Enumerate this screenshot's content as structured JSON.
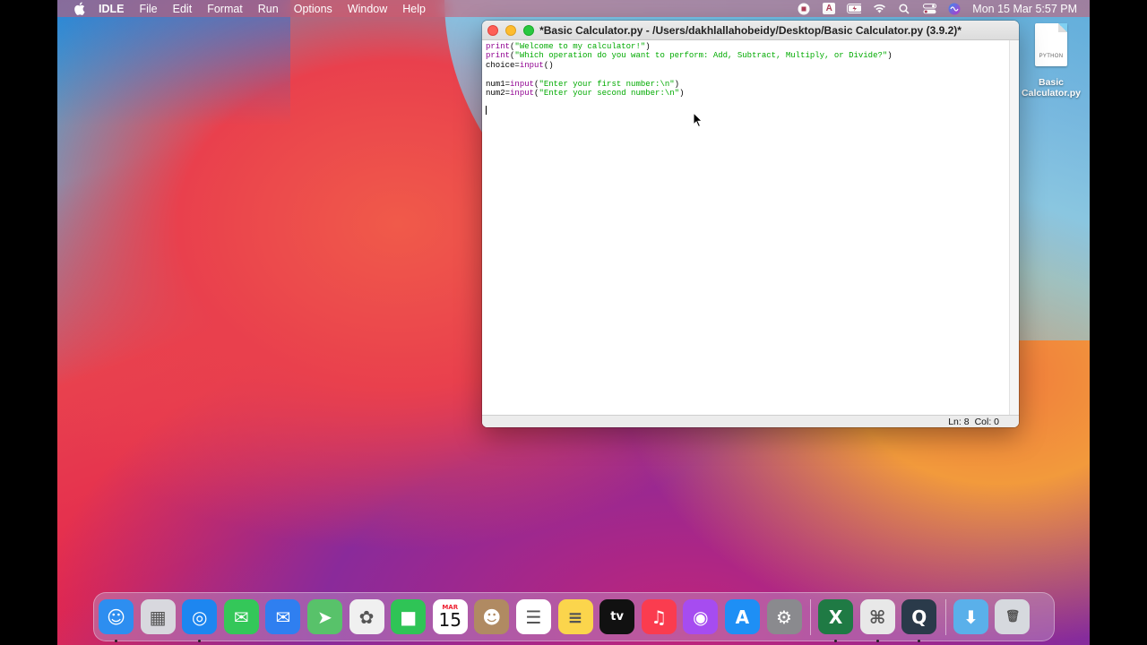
{
  "menubar": {
    "app_name": "IDLE",
    "items": [
      "File",
      "Edit",
      "Format",
      "Run",
      "Options",
      "Window",
      "Help"
    ],
    "input_source": "A",
    "clock": "Mon 15 Mar  5:57 PM"
  },
  "desktop": {
    "file": {
      "tag": "PYTHON",
      "name_line1": "Basic",
      "name_line2": "Calculator.py"
    }
  },
  "window": {
    "title": "*Basic Calculator.py - /Users/dakhlallahobeidy/Desktop/Basic Calculator.py (3.9.2)*",
    "code_lines": [
      [
        {
          "t": "print",
          "c": "kw"
        },
        {
          "t": "(",
          "c": "plain"
        },
        {
          "t": "\"Welcome to my calculator!\"",
          "c": "str"
        },
        {
          "t": ")",
          "c": "plain"
        }
      ],
      [
        {
          "t": "print",
          "c": "kw"
        },
        {
          "t": "(",
          "c": "plain"
        },
        {
          "t": "\"Which operation do you want to perform: Add, Subtract, Multiply, or Divide?\"",
          "c": "str"
        },
        {
          "t": ")",
          "c": "plain"
        }
      ],
      [
        {
          "t": "choice=",
          "c": "plain"
        },
        {
          "t": "input",
          "c": "kw"
        },
        {
          "t": "()",
          "c": "plain"
        }
      ],
      [],
      [
        {
          "t": "num1=",
          "c": "plain"
        },
        {
          "t": "input",
          "c": "kw"
        },
        {
          "t": "(",
          "c": "plain"
        },
        {
          "t": "\"Enter your first number:\\n\"",
          "c": "str"
        },
        {
          "t": ")",
          "c": "plain"
        }
      ],
      [
        {
          "t": "num2=",
          "c": "plain"
        },
        {
          "t": "input",
          "c": "kw"
        },
        {
          "t": "(",
          "c": "plain"
        },
        {
          "t": "\"Enter your second number:\\n\"",
          "c": "str"
        },
        {
          "t": ")",
          "c": "plain"
        }
      ],
      [],
      []
    ],
    "status": {
      "line": "Ln: 8",
      "col": "Col: 0"
    }
  },
  "dock": {
    "calendar_month": "MAR",
    "calendar_day": "15",
    "apps": [
      {
        "name": "finder-app",
        "color": "#2d8ef0",
        "glyph": "☺",
        "running": true
      },
      {
        "name": "launchpad-app",
        "color": "#d8d8de",
        "glyph": "▦",
        "running": false
      },
      {
        "name": "safari-app",
        "color": "#1d86f0",
        "glyph": "◎",
        "running": true
      },
      {
        "name": "messages-app",
        "color": "#34c759",
        "glyph": "✉",
        "running": false
      },
      {
        "name": "mail-app",
        "color": "#2f7ff0",
        "glyph": "✉",
        "running": false
      },
      {
        "name": "maps-app",
        "color": "#58c26a",
        "glyph": "➤",
        "running": false
      },
      {
        "name": "photos-app",
        "color": "#f0f0f0",
        "glyph": "✿",
        "running": false
      },
      {
        "name": "facetime-app",
        "color": "#2fc456",
        "glyph": "■",
        "running": false
      },
      {
        "name": "calendar-app",
        "color": "#ffffff",
        "glyph": "",
        "running": false
      },
      {
        "name": "contacts-app",
        "color": "#b08a62",
        "glyph": "☻",
        "running": false
      },
      {
        "name": "reminders-app",
        "color": "#ffffff",
        "glyph": "☰",
        "running": false
      },
      {
        "name": "notes-app",
        "color": "#fbd54c",
        "glyph": "≡",
        "running": false
      },
      {
        "name": "tv-app",
        "color": "#111111",
        "glyph": "tv",
        "running": false
      },
      {
        "name": "music-app",
        "color": "#fa3c4f",
        "glyph": "♫",
        "running": false
      },
      {
        "name": "podcasts-app",
        "color": "#a64cf0",
        "glyph": "◉",
        "running": false
      },
      {
        "name": "app-store-app",
        "color": "#1e8ff5",
        "glyph": "A",
        "running": false
      },
      {
        "name": "system-preferences-app",
        "color": "#8a8a8e",
        "glyph": "⚙",
        "running": false
      },
      {
        "name": "excel-app",
        "color": "#1f7a44",
        "glyph": "X",
        "running": true
      },
      {
        "name": "python-launcher-app",
        "color": "#e8e8e8",
        "glyph": "⌘",
        "running": true
      },
      {
        "name": "quicktime-app",
        "color": "#2a3a4a",
        "glyph": "Q",
        "running": true
      }
    ],
    "right_items": [
      {
        "name": "downloads-folder",
        "color": "#5ab0ea",
        "glyph": "⬇"
      },
      {
        "name": "trash",
        "color": "#d6d9de",
        "glyph": "🗑"
      }
    ]
  }
}
